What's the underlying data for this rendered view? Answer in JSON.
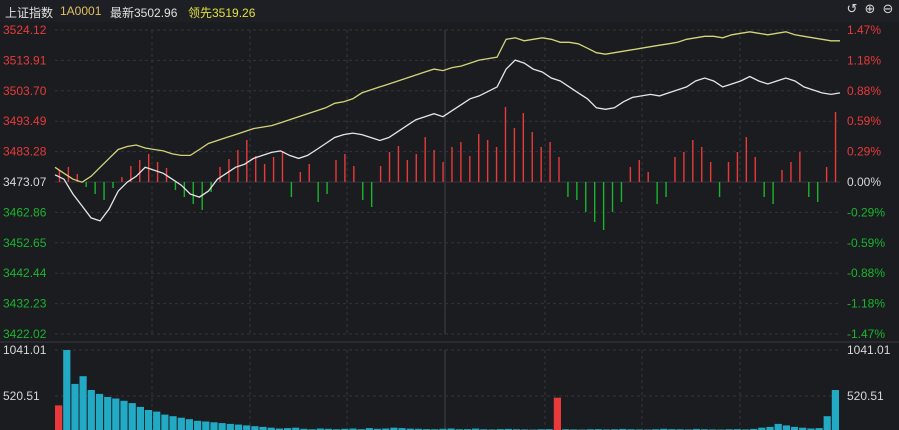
{
  "header": {
    "name": "上证指数",
    "code": "1A0001",
    "last_label": "最新3502.96",
    "lead_label": "领先3519.26",
    "icons": [
      "refresh-icon",
      "zoom-in-icon",
      "zoom-out-icon"
    ]
  },
  "colors": {
    "up": "#e83a3a",
    "down": "#19b52e",
    "flat": "#d8d8d8",
    "lead_line": "#d4d47a",
    "price_line": "#e6e6e6",
    "volume": "#22a9c4",
    "grid": "#34343c"
  },
  "chart_data": [
    {
      "type": "line",
      "name": "price-panel",
      "series": [
        {
          "name": "最新",
          "values": [
            3475.5,
            3474,
            3469,
            3465,
            3461,
            3460,
            3464,
            3470,
            3473,
            3475,
            3478,
            3477,
            3476,
            3474,
            3472,
            3469,
            3468,
            3470,
            3474,
            3476,
            3478,
            3479,
            3481,
            3482,
            3483,
            3483.5,
            3482,
            3481,
            3482,
            3484,
            3486,
            3488,
            3489,
            3489.5,
            3489,
            3488,
            3487,
            3488,
            3490,
            3492,
            3494,
            3495,
            3496,
            3495,
            3497,
            3499,
            3501,
            3502,
            3503.5,
            3505,
            3511,
            3514,
            3513,
            3511,
            3510,
            3508,
            3507,
            3505,
            3503,
            3501,
            3498,
            3497.5,
            3498,
            3500,
            3501.5,
            3502,
            3502.5,
            3502,
            3503,
            3504,
            3505,
            3507,
            3508,
            3507,
            3505,
            3506,
            3507,
            3508.5,
            3507,
            3506,
            3507,
            3508,
            3507,
            3505,
            3504,
            3503,
            3502.5,
            3503
          ]
        },
        {
          "name": "领先",
          "values": [
            3478,
            3476,
            3474,
            3473,
            3475,
            3478,
            3481,
            3484,
            3485,
            3485.5,
            3484.5,
            3484,
            3483.5,
            3482.5,
            3482,
            3482,
            3484,
            3486,
            3487,
            3488,
            3489,
            3490,
            3491,
            3491.5,
            3492,
            3493,
            3494,
            3495,
            3496,
            3497,
            3498,
            3499.5,
            3500,
            3501,
            3503,
            3504,
            3505,
            3506,
            3507,
            3508,
            3509,
            3510,
            3511,
            3510.5,
            3511.5,
            3512,
            3513,
            3514,
            3514.5,
            3515,
            3521,
            3521.5,
            3520.5,
            3521,
            3521.5,
            3521,
            3520,
            3520,
            3519.5,
            3518,
            3516.5,
            3516,
            3516.5,
            3517,
            3517.5,
            3518,
            3518.5,
            3519,
            3519.5,
            3520,
            3521,
            3521.5,
            3522,
            3522,
            3521.5,
            3522.5,
            3523,
            3523.5,
            3523,
            3522.5,
            3523,
            3523.5,
            3522.5,
            3522,
            3521.5,
            3521,
            3520.5,
            3520.5
          ]
        }
      ],
      "bars": [
        1.2,
        1.5,
        0.8,
        -0.5,
        -1.2,
        -1.8,
        -0.6,
        0.5,
        1.6,
        2.2,
        2.8,
        2.0,
        1.4,
        -0.8,
        -1.5,
        -2.2,
        -2.8,
        -1.0,
        1.5,
        2.3,
        3.2,
        4.2,
        2.6,
        1.8,
        2.5,
        3.0,
        -1.5,
        1.0,
        1.8,
        -2.0,
        -1.2,
        2.2,
        2.8,
        1.6,
        -1.8,
        -2.5,
        1.6,
        3.0,
        3.6,
        2.2,
        2.8,
        4.5,
        3.2,
        2.0,
        3.5,
        4.0,
        2.6,
        4.8,
        4.2,
        3.5,
        7.5,
        5.4,
        6.9,
        5.0,
        3.5,
        4.0,
        2.5,
        -1.5,
        -1.8,
        -3.0,
        -4.0,
        -4.8,
        -3.0,
        -2.0,
        1.5,
        2.2,
        1.0,
        -2.2,
        -1.5,
        2.5,
        3.0,
        4.2,
        3.5,
        2.0,
        -1.5,
        2.0,
        3.0,
        4.5,
        2.5,
        -1.5,
        -2.2,
        1.2,
        2.0,
        3.0,
        -1.5,
        -2.0,
        1.5,
        7.0
      ],
      "y_ticks_left": [
        "3524.12",
        "3513.91",
        "3503.70",
        "3493.49",
        "3483.28",
        "3473.07",
        "3462.86",
        "3452.65",
        "3442.44",
        "3432.23",
        "3422.02"
      ],
      "y_ticks_right": [
        "1.47%",
        "1.18%",
        "0.88%",
        "0.59%",
        "0.29%",
        "0.00%",
        "-0.29%",
        "-0.59%",
        "-0.88%",
        "-1.18%",
        "-1.47%"
      ],
      "ylim": [
        3422.02,
        3524.12
      ],
      "baseline": 3473.07,
      "grid": true
    },
    {
      "type": "bar",
      "name": "volume-panel",
      "values": [
        320,
        1041,
        600,
        700,
        520,
        470,
        430,
        410,
        380,
        350,
        300,
        260,
        240,
        200,
        180,
        160,
        140,
        120,
        110,
        100,
        90,
        80,
        70,
        60,
        50,
        40,
        30,
        20,
        25,
        30,
        15,
        10,
        20,
        15,
        10,
        15,
        20,
        10,
        25,
        15,
        20,
        30,
        25,
        18,
        15,
        12,
        10,
        15,
        20,
        10,
        12,
        18,
        10,
        8,
        12,
        14,
        10,
        8,
        6,
        10,
        12,
        420,
        10,
        8,
        6,
        10,
        12,
        8,
        10,
        14,
        10,
        8,
        6,
        10,
        15,
        12,
        10,
        8,
        14,
        10,
        8,
        6,
        10,
        12,
        8,
        14,
        30,
        40,
        80,
        60,
        40,
        30,
        20,
        25,
        180,
        520
      ],
      "y_ticks_left": [
        "1041.01",
        "520.51"
      ],
      "y_ticks_right": [
        "1041.01",
        "520.51"
      ],
      "ylim": [
        0,
        1041.01
      ]
    }
  ]
}
